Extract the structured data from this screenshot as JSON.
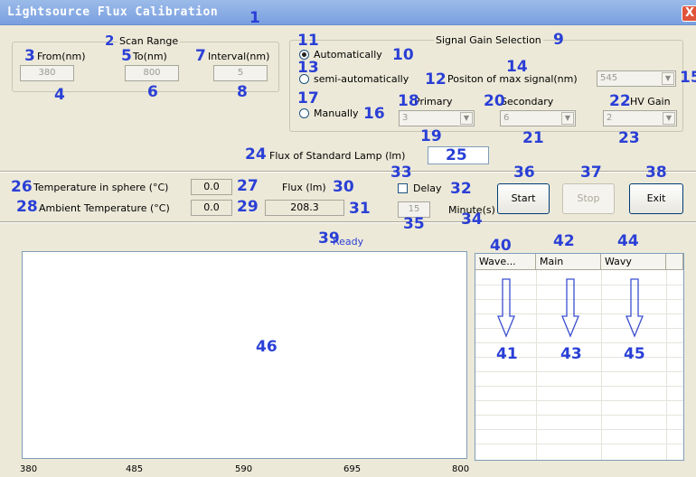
{
  "window": {
    "title": "Lightsource Flux Calibration",
    "close_glyph": "X"
  },
  "scan_range": {
    "title": "Scan Range",
    "from_label": "From(nm)",
    "from_value": "380",
    "to_label": "To(nm)",
    "to_value": "800",
    "interval_label": "Interval(nm)",
    "interval_value": "5"
  },
  "gain": {
    "title": "Signal Gain Selection",
    "auto_label": "Automatically",
    "semi_label": "semi-automatically",
    "max_signal_label": "Positon of max signal(nm)",
    "max_signal_value": "545",
    "manual_label": "Manually",
    "primary_label": "Primary",
    "primary_value": "3",
    "secondary_label": "Secondary",
    "secondary_value": "6",
    "hv_label": "HV Gain",
    "hv_value": "2"
  },
  "std_lamp": {
    "label": "Flux of Standard Lamp (lm)",
    "value": ""
  },
  "readings": {
    "temp_sphere_label": "Temperature in sphere (°C)",
    "temp_sphere_value": "0.0",
    "ambient_label": "Ambient Temperature (°C)",
    "ambient_value": "0.0",
    "flux_label": "Flux (lm)",
    "flux_value": "208.3"
  },
  "delay": {
    "label": "Delay",
    "value": "15",
    "unit": "Minute(s)"
  },
  "buttons": {
    "start": "Start",
    "stop": "Stop",
    "exit": "Exit"
  },
  "status": "Ready",
  "chart_data": {
    "type": "line",
    "x_ticks": [
      "380",
      "485",
      "590",
      "695",
      "800"
    ],
    "series": []
  },
  "table": {
    "columns": [
      "Wave...",
      "Main",
      "Wavy"
    ]
  },
  "markers": {
    "m1": "1",
    "m2": "2",
    "m3": "3",
    "m4": "4",
    "m5": "5",
    "m6": "6",
    "m7": "7",
    "m8": "8",
    "m9": "9",
    "m10": "10",
    "m11": "11",
    "m12": "12",
    "m13": "13",
    "m14": "14",
    "m15": "15",
    "m16": "16",
    "m17": "17",
    "m18": "18",
    "m19": "19",
    "m20": "20",
    "m21": "21",
    "m22": "22",
    "m23": "23",
    "m24": "24",
    "m25": "25",
    "m26": "26",
    "m27": "27",
    "m28": "28",
    "m29": "29",
    "m30": "30",
    "m31": "31",
    "m32": "32",
    "m33": "33",
    "m34": "34",
    "m35": "35",
    "m36": "36",
    "m37": "37",
    "m38": "38",
    "m39": "39",
    "m40": "40",
    "m41": "41",
    "m42": "42",
    "m43": "43",
    "m44": "44",
    "m45": "45",
    "m46": "46"
  }
}
